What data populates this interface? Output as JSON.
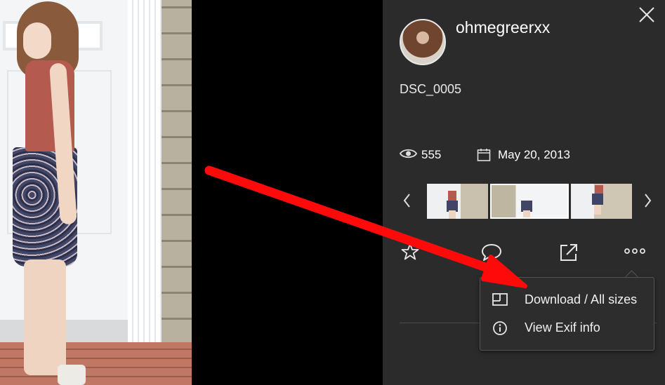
{
  "profile": {
    "username": "ohmegreerxx",
    "avatar_alt": "user-avatar"
  },
  "photo": {
    "title": "DSC_0005",
    "views": "555",
    "date": "May 20, 2013"
  },
  "filmstrip": {
    "thumbnails": [
      "thumb-1",
      "thumb-2",
      "thumb-3"
    ],
    "selected_index": 1
  },
  "actions": {
    "icons": [
      "star-icon",
      "comment-icon",
      "share-icon",
      "more-icon"
    ]
  },
  "menu": {
    "items": [
      {
        "label": "Download / All sizes",
        "icon": "download-sizes-icon"
      },
      {
        "label": "View Exif info",
        "icon": "info-icon"
      }
    ]
  },
  "colors": {
    "panel_bg": "#2b2b2b",
    "menu_bg": "#2d2d2d",
    "arrow": "#ff0000",
    "text": "#ffffff"
  }
}
